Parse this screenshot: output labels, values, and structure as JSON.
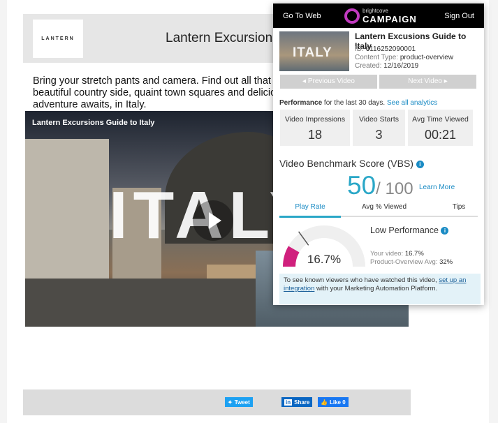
{
  "email": {
    "logo_text": "LANTERN",
    "header_title": "Lantern Excursions Guide to Italy",
    "intro": "Bring your stretch pants and camera. Find out all that Italy has to offer, from the beautiful country side, quaint town squares and delicious food and wine. Your next adventure awaits, in Italy.",
    "video_title": "Lantern Excursions Guide to Italy",
    "video_word": "ITALY",
    "tweet_label": "Tweet",
    "share_label": "Share",
    "like_label": "Like 0"
  },
  "popup": {
    "go_to_web": "Go To Web",
    "brand_small": "brightcove",
    "brand_big": "CAMPAIGN",
    "sign_out": "Sign Out",
    "thumb_word": "ITALY",
    "video_name": "Lantern Excusions Guide to Italy",
    "id_label": "ID:",
    "id_value": "6116252090001",
    "content_type_label": "Content Type:",
    "content_type_value": "product-overview",
    "created_label": "Created:",
    "created_value": "12/16/2019",
    "prev_label": "◂ Previous Video",
    "next_label": "Next Video ▸",
    "perf_label": "Performance",
    "perf_period": " for the last 30 days. ",
    "see_all": "See all analytics",
    "stats": [
      {
        "label": "Video Impressions",
        "value": "18"
      },
      {
        "label": "Video Starts",
        "value": "3"
      },
      {
        "label": "Avg Time Viewed",
        "value": "00:21"
      }
    ],
    "vbs_title": "Video Benchmark Score (VBS)",
    "score_value": "50",
    "score_total": "/ 100",
    "learn_more": "Learn More",
    "tabs": [
      "Play Rate",
      "Avg % Viewed",
      "Tips"
    ],
    "gauge_value": "16.7%",
    "gauge_fraction": 0.167,
    "performance_status": "Low Performance",
    "your_video_label": "Your video:",
    "your_video_value": "16.7%",
    "avg_label": "Product-Overview Avg:",
    "avg_value": "32%",
    "note_pre": "To see known viewers who have watched this video, ",
    "note_link": "set up an integration",
    "note_post": " with your Marketing Automation Platform."
  },
  "colors": {
    "accent": "#2aa7c7",
    "brand": "#c13abf",
    "gauge": "#d0207d",
    "link": "#1a8bc4"
  }
}
